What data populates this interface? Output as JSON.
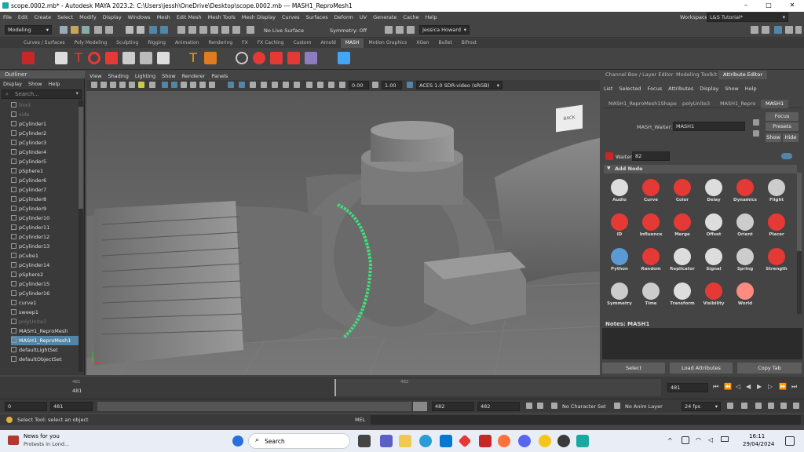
{
  "window": {
    "title": "scope.0002.mb* - Autodesk MAYA 2023.2: C:\\Users\\jessh\\OneDrive\\Desktop\\scope.0002.mb   ---   MASH1_ReproMesh1",
    "min": "–",
    "max": "□",
    "close": "✕"
  },
  "menus": [
    "File",
    "Edit",
    "Create",
    "Select",
    "Modify",
    "Display",
    "Windows",
    "Mesh",
    "Edit Mesh",
    "Mesh Tools",
    "Mesh Display",
    "Curves",
    "Surfaces",
    "Deform",
    "UV",
    "Generate",
    "Cache",
    "Help"
  ],
  "workspace": {
    "label": "Workspace :",
    "value": "L&S Tutorial*"
  },
  "status": {
    "menuset": "Modeling",
    "live": "No Live Surface",
    "symmetry": "Symmetry: Off",
    "user": "Jessica Howard"
  },
  "shelf_tabs": [
    "Curves / Surfaces",
    "Poly Modeling",
    "Sculpting",
    "Rigging",
    "Animation",
    "Rendering",
    "FX",
    "FX Caching",
    "Custom",
    "Arnold",
    "MASH",
    "Motion Graphics",
    "XGen",
    "Bullet",
    "Bifrost"
  ],
  "shelf_active": "MASH",
  "outliner": {
    "title": "Outliner",
    "menus": [
      "Display",
      "Show",
      "Help"
    ],
    "search": "Search...",
    "items": [
      {
        "label": "front",
        "state": "dim"
      },
      {
        "label": "side",
        "state": "dim"
      },
      {
        "label": "pCylinder1",
        "state": ""
      },
      {
        "label": "pCylinder2",
        "state": ""
      },
      {
        "label": "pCylinder3",
        "state": ""
      },
      {
        "label": "pCylinder4",
        "state": ""
      },
      {
        "label": "pCylinder5",
        "state": ""
      },
      {
        "label": "pSphere1",
        "state": ""
      },
      {
        "label": "pCylinder6",
        "state": ""
      },
      {
        "label": "pCylinder7",
        "state": ""
      },
      {
        "label": "pCylinder8",
        "state": ""
      },
      {
        "label": "pCylinder9",
        "state": ""
      },
      {
        "label": "pCylinder10",
        "state": ""
      },
      {
        "label": "pCylinder11",
        "state": ""
      },
      {
        "label": "pCylinder12",
        "state": ""
      },
      {
        "label": "pCylinder13",
        "state": ""
      },
      {
        "label": "pCube1",
        "state": ""
      },
      {
        "label": "pCylinder14",
        "state": ""
      },
      {
        "label": "pSphere2",
        "state": ""
      },
      {
        "label": "pCylinder15",
        "state": ""
      },
      {
        "label": "pCylinder16",
        "state": ""
      },
      {
        "label": "curve1",
        "state": ""
      },
      {
        "label": "sweep1",
        "state": ""
      },
      {
        "label": "polyUnite3",
        "state": "dim"
      },
      {
        "label": "MASH1_ReproMesh",
        "state": ""
      },
      {
        "label": "MASH1_ReproMesh1",
        "state": "sel"
      },
      {
        "label": "defaultLightSet",
        "state": ""
      },
      {
        "label": "defaultObjectSet",
        "state": ""
      }
    ]
  },
  "viewport": {
    "menus": [
      "View",
      "Shading",
      "Lighting",
      "Show",
      "Renderer",
      "Panels"
    ],
    "exposure": "0.00",
    "gamma": "1.00",
    "colorspace": "ACES 1.0 SDR-video (sRGB)",
    "cube_label": "BACK"
  },
  "ae": {
    "tabs": [
      "Channel Box / Layer Editor",
      "Modeling Toolkit",
      "Attribute Editor"
    ],
    "menus": [
      "List",
      "Selected",
      "Focus",
      "Attributes",
      "Display",
      "Show",
      "Help"
    ],
    "nodetabs": [
      "MASH1_ReproMesh1Shape",
      "polyUnite3",
      "MASH1_Repro",
      "MASH1"
    ],
    "waiter_label": "MASH_Waiter:",
    "waiter_value": "MASH1",
    "focus": "Focus",
    "presets": "Presets",
    "show": "Show",
    "hide": "Hide",
    "waiter2_label": "Waiter:",
    "waiter2_value": "82",
    "addnode": "Add Node",
    "nodes": [
      "Audio",
      "Curve",
      "Color",
      "Delay",
      "Dynamics",
      "Flight",
      "ID",
      "Influence",
      "Merge",
      "Offset",
      "Orient",
      "Placer",
      "Python",
      "Random",
      "Replicator",
      "Signal",
      "Spring",
      "Strength",
      "Symmetry",
      "Time",
      "Transform",
      "Visibility",
      "World"
    ],
    "notes": "Notes: MASH1",
    "select": "Select",
    "load": "Load Attributes",
    "copytab": "Copy Tab"
  },
  "timeline": {
    "current": "481",
    "tick482": "482",
    "frame_box": "481"
  },
  "range": {
    "start": "0",
    "rstart": "481",
    "rend_a": "482",
    "rend_b": "482",
    "character": "No Character Set",
    "anim": "No Anim Layer",
    "fps": "24 fps"
  },
  "help": {
    "mel": "MEL",
    "text": "Select Tool: select an object"
  },
  "taskbar": {
    "news": "News for you",
    "news2": "Protests in Lond...",
    "search": "Search",
    "time": "16:11",
    "date": "29/04/2024"
  },
  "colors": {
    "accent": "#5285a6",
    "curve": "#3ee07a",
    "mash": "#c62828"
  }
}
